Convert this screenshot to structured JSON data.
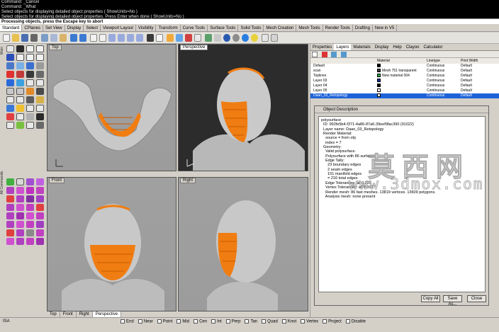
{
  "command_history": [
    "Command: _Cancel",
    "Command: _What",
    "Select objects for displaying detailed object properties ( ShowUnits=No )",
    "Select objects for displaying detailed object properties. Press Enter when done ( ShowUnits=No )"
  ],
  "command_prompt": "Processing objects, press the Escape key to abort",
  "toolbar_tabs": [
    "Standard",
    "CPlanes",
    "Set View",
    "Display",
    "Select",
    "Viewport Layout",
    "Visibility",
    "Transform",
    "Curve Tools",
    "Surface Tools",
    "Solid Tools",
    "Mesh Creation",
    "Mesh Tools",
    "Render Tools",
    "Drafting",
    "New in V5"
  ],
  "side_labels": {
    "main": "Main",
    "commands": "All Commands"
  },
  "viewports": {
    "top": "Top",
    "perspective": "Perspective",
    "front": "Front",
    "right": "Right"
  },
  "viewport_tabs": [
    "Top",
    "Front",
    "Right",
    "Perspective"
  ],
  "status": {
    "coords": "ISA",
    "snaps": [
      "End",
      "Near",
      "Point",
      "Mid",
      "Cen",
      "Int",
      "Perp",
      "Tan",
      "Quad",
      "Knot",
      "Vertex",
      "Project",
      "Disable"
    ]
  },
  "panel_tabs": [
    "Properties",
    "Layers",
    "Materials",
    "Display",
    "Help",
    "Clayoo",
    "Calculator"
  ],
  "layers": {
    "columns": [
      "",
      "Material",
      "Linetype",
      "Print Width"
    ],
    "rows": [
      {
        "name": "Default",
        "material": "",
        "linetype": "Continuous",
        "width": "Default",
        "color": "#000000"
      },
      {
        "name": "scan",
        "material": "Mesh 751 transparent",
        "linetype": "Continuous",
        "width": "Default",
        "color": "#3a3a3a"
      },
      {
        "name": "Toplines",
        "material": "New material 004",
        "linetype": "Continuous",
        "width": "Default",
        "color": "#2ea84a"
      },
      {
        "name": "Layer 03",
        "material": "",
        "linetype": "Continuous",
        "width": "Default",
        "color": "#0a2c9e"
      },
      {
        "name": "Layer 04",
        "material": "",
        "linetype": "Continuous",
        "width": "Default",
        "color": "#000000"
      },
      {
        "name": "Layer 05",
        "material": "",
        "linetype": "Continuous",
        "width": "Default",
        "color": "#ffffff"
      },
      {
        "name": "Daan_03_Retopology",
        "material": "",
        "linetype": "Continuous",
        "width": "Default",
        "color": "#e8e8e8",
        "selected": true
      }
    ]
  },
  "dialog": {
    "title": "Object Description",
    "lines": [
      "polysurface",
      "  ID: 992fe5b4-f371-4a86-87a6-39eef9fac390 (91022)",
      "  Layer name: Daan_03_Retopology",
      "  Render Material:",
      "    source = from obj",
      "    index = 7",
      "  Geometry:",
      "    Valid polysurface.",
      "    Polysurface with 86 surfaces.",
      "    Edge Tally:",
      "      23 boundary edges",
      "      2 seam edges",
      "      151 manifold edges",
      "      = 216 total edges",
      "    Edge Tolerances: all 0.001",
      "    Vertex Tolerances: all 0.001",
      "    Render mesh: 86 fast meshes. 13819 vertices. 13609 polygons.",
      "    Analysis mesh: none present"
    ],
    "buttons": {
      "copy": "Copy All",
      "save": "Save As...",
      "close": "Close"
    }
  },
  "watermark": {
    "cn": "莫西网",
    "url": "www.3dmox.com"
  },
  "colors": {
    "accent": "#1d62d8",
    "mesh": "#c8c8c8",
    "retopo": "#f07d12"
  }
}
